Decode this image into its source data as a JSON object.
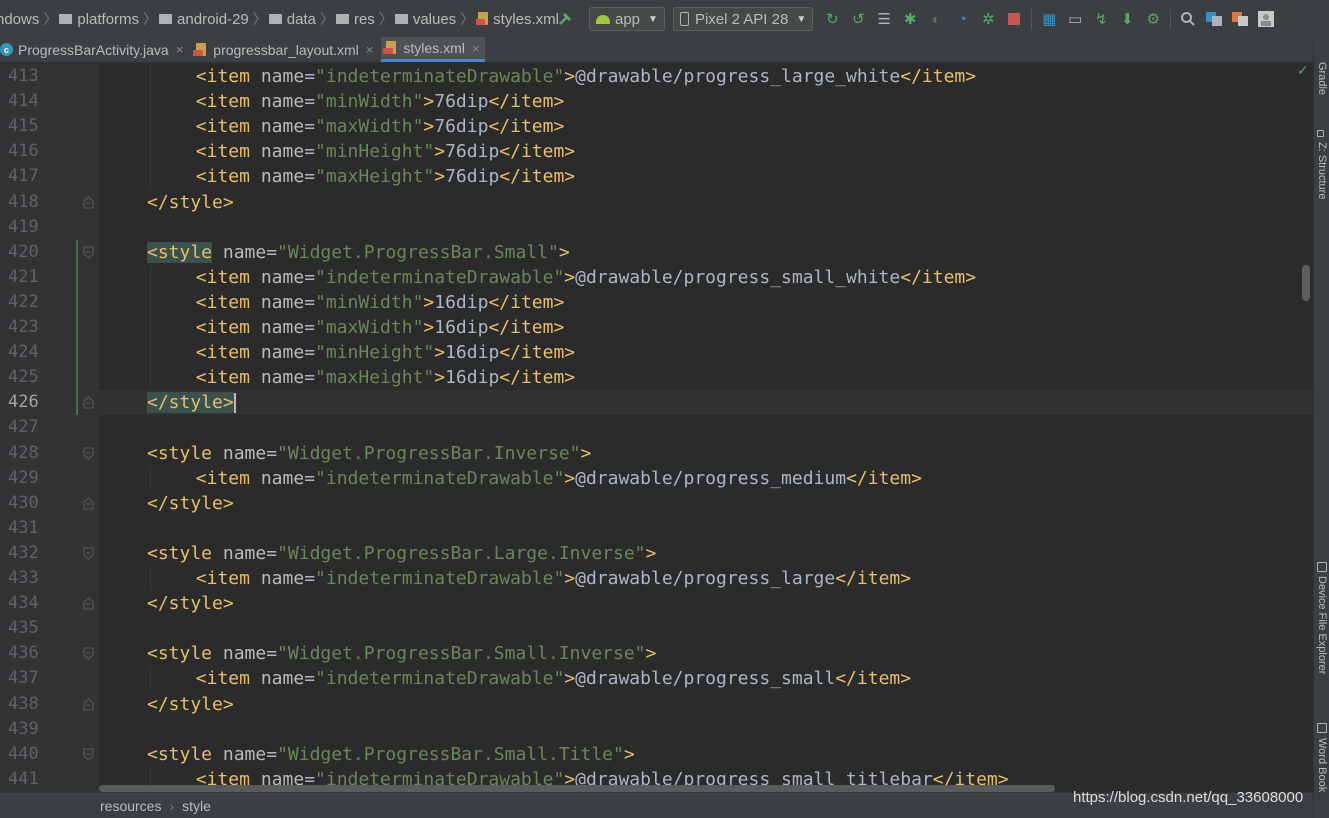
{
  "breadcrumb": [
    "ndows",
    "platforms",
    "android-29",
    "data",
    "res",
    "values",
    "styles.xml"
  ],
  "toolbar": {
    "run_config": "app",
    "device": "Pixel 2 API 28"
  },
  "tabs": [
    {
      "label": "ProgressBarActivity.java",
      "active": false
    },
    {
      "label": "progressbar_layout.xml",
      "active": false
    },
    {
      "label": "styles.xml",
      "active": true
    }
  ],
  "editor": {
    "current_line": 426,
    "lines": [
      {
        "num": "413",
        "indent": 2,
        "tokens": [
          [
            "tg",
            "<item "
          ],
          [
            "at",
            "name"
          ],
          [
            "tx",
            "="
          ],
          [
            "sv",
            "\"indeterminateDrawable\""
          ],
          [
            "tg",
            ">"
          ],
          [
            "tx",
            "@drawable/progress_large_white"
          ],
          [
            "tg",
            "</item>"
          ]
        ]
      },
      {
        "num": "414",
        "indent": 2,
        "tokens": [
          [
            "tg",
            "<item "
          ],
          [
            "at",
            "name"
          ],
          [
            "tx",
            "="
          ],
          [
            "sv",
            "\"minWidth\""
          ],
          [
            "tg",
            ">"
          ],
          [
            "tx",
            "76dip"
          ],
          [
            "tg",
            "</item>"
          ]
        ]
      },
      {
        "num": "415",
        "indent": 2,
        "tokens": [
          [
            "tg",
            "<item "
          ],
          [
            "at",
            "name"
          ],
          [
            "tx",
            "="
          ],
          [
            "sv",
            "\"maxWidth\""
          ],
          [
            "tg",
            ">"
          ],
          [
            "tx",
            "76dip"
          ],
          [
            "tg",
            "</item>"
          ]
        ]
      },
      {
        "num": "416",
        "indent": 2,
        "tokens": [
          [
            "tg",
            "<item "
          ],
          [
            "at",
            "name"
          ],
          [
            "tx",
            "="
          ],
          [
            "sv",
            "\"minHeight\""
          ],
          [
            "tg",
            ">"
          ],
          [
            "tx",
            "76dip"
          ],
          [
            "tg",
            "</item>"
          ]
        ]
      },
      {
        "num": "417",
        "indent": 2,
        "tokens": [
          [
            "tg",
            "<item "
          ],
          [
            "at",
            "name"
          ],
          [
            "tx",
            "="
          ],
          [
            "sv",
            "\"maxHeight\""
          ],
          [
            "tg",
            ">"
          ],
          [
            "tx",
            "76dip"
          ],
          [
            "tg",
            "</item>"
          ]
        ]
      },
      {
        "num": "418",
        "indent": 1,
        "fold": "end",
        "tokens": [
          [
            "tg",
            "</style>"
          ]
        ]
      },
      {
        "num": "419",
        "indent": 0,
        "tokens": []
      },
      {
        "num": "420",
        "indent": 1,
        "fold": "start",
        "tokens": [
          [
            "tgh",
            "<style"
          ],
          [
            "tx",
            " "
          ],
          [
            "at",
            "name"
          ],
          [
            "tx",
            "="
          ],
          [
            "sv",
            "\"Widget.ProgressBar.Small\""
          ],
          [
            "tg",
            ">"
          ]
        ]
      },
      {
        "num": "421",
        "indent": 2,
        "tokens": [
          [
            "tg",
            "<item "
          ],
          [
            "at",
            "name"
          ],
          [
            "tx",
            "="
          ],
          [
            "sv",
            "\"indeterminateDrawable\""
          ],
          [
            "tg",
            ">"
          ],
          [
            "tx",
            "@drawable/progress_small_white"
          ],
          [
            "tg",
            "</item>"
          ]
        ]
      },
      {
        "num": "422",
        "indent": 2,
        "tokens": [
          [
            "tg",
            "<item "
          ],
          [
            "at",
            "name"
          ],
          [
            "tx",
            "="
          ],
          [
            "sv",
            "\"minWidth\""
          ],
          [
            "tg",
            ">"
          ],
          [
            "tx",
            "16dip"
          ],
          [
            "tg",
            "</item>"
          ]
        ]
      },
      {
        "num": "423",
        "indent": 2,
        "tokens": [
          [
            "tg",
            "<item "
          ],
          [
            "at",
            "name"
          ],
          [
            "tx",
            "="
          ],
          [
            "sv",
            "\"maxWidth\""
          ],
          [
            "tg",
            ">"
          ],
          [
            "tx",
            "16dip"
          ],
          [
            "tg",
            "</item>"
          ]
        ]
      },
      {
        "num": "424",
        "indent": 2,
        "tokens": [
          [
            "tg",
            "<item "
          ],
          [
            "at",
            "name"
          ],
          [
            "tx",
            "="
          ],
          [
            "sv",
            "\"minHeight\""
          ],
          [
            "tg",
            ">"
          ],
          [
            "tx",
            "16dip"
          ],
          [
            "tg",
            "</item>"
          ]
        ]
      },
      {
        "num": "425",
        "indent": 2,
        "tokens": [
          [
            "tg",
            "<item "
          ],
          [
            "at",
            "name"
          ],
          [
            "tx",
            "="
          ],
          [
            "sv",
            "\"maxHeight\""
          ],
          [
            "tg",
            ">"
          ],
          [
            "tx",
            "16dip"
          ],
          [
            "tg",
            "</item>"
          ]
        ]
      },
      {
        "num": "426",
        "indent": 1,
        "fold": "end",
        "caret": true,
        "tokens": [
          [
            "tgh",
            "</style>"
          ]
        ]
      },
      {
        "num": "427",
        "indent": 0,
        "tokens": []
      },
      {
        "num": "428",
        "indent": 1,
        "fold": "start",
        "tokens": [
          [
            "tg",
            "<style "
          ],
          [
            "at",
            "name"
          ],
          [
            "tx",
            "="
          ],
          [
            "sv",
            "\"Widget.ProgressBar.Inverse\""
          ],
          [
            "tg",
            ">"
          ]
        ]
      },
      {
        "num": "429",
        "indent": 2,
        "tokens": [
          [
            "tg",
            "<item "
          ],
          [
            "at",
            "name"
          ],
          [
            "tx",
            "="
          ],
          [
            "sv",
            "\"indeterminateDrawable\""
          ],
          [
            "tg",
            ">"
          ],
          [
            "tx",
            "@drawable/progress_medium"
          ],
          [
            "tg",
            "</item>"
          ]
        ]
      },
      {
        "num": "430",
        "indent": 1,
        "fold": "end",
        "tokens": [
          [
            "tg",
            "</style>"
          ]
        ]
      },
      {
        "num": "431",
        "indent": 0,
        "tokens": []
      },
      {
        "num": "432",
        "indent": 1,
        "fold": "start",
        "tokens": [
          [
            "tg",
            "<style "
          ],
          [
            "at",
            "name"
          ],
          [
            "tx",
            "="
          ],
          [
            "sv",
            "\"Widget.ProgressBar.Large.Inverse\""
          ],
          [
            "tg",
            ">"
          ]
        ]
      },
      {
        "num": "433",
        "indent": 2,
        "tokens": [
          [
            "tg",
            "<item "
          ],
          [
            "at",
            "name"
          ],
          [
            "tx",
            "="
          ],
          [
            "sv",
            "\"indeterminateDrawable\""
          ],
          [
            "tg",
            ">"
          ],
          [
            "tx",
            "@drawable/progress_large"
          ],
          [
            "tg",
            "</item>"
          ]
        ]
      },
      {
        "num": "434",
        "indent": 1,
        "fold": "end",
        "tokens": [
          [
            "tg",
            "</style>"
          ]
        ]
      },
      {
        "num": "435",
        "indent": 0,
        "tokens": []
      },
      {
        "num": "436",
        "indent": 1,
        "fold": "start",
        "tokens": [
          [
            "tg",
            "<style "
          ],
          [
            "at",
            "name"
          ],
          [
            "tx",
            "="
          ],
          [
            "sv",
            "\"Widget.ProgressBar.Small.Inverse\""
          ],
          [
            "tg",
            ">"
          ]
        ]
      },
      {
        "num": "437",
        "indent": 2,
        "tokens": [
          [
            "tg",
            "<item "
          ],
          [
            "at",
            "name"
          ],
          [
            "tx",
            "="
          ],
          [
            "sv",
            "\"indeterminateDrawable\""
          ],
          [
            "tg",
            ">"
          ],
          [
            "tx",
            "@drawable/progress_small"
          ],
          [
            "tg",
            "</item>"
          ]
        ]
      },
      {
        "num": "438",
        "indent": 1,
        "fold": "end",
        "tokens": [
          [
            "tg",
            "</style>"
          ]
        ]
      },
      {
        "num": "439",
        "indent": 0,
        "tokens": []
      },
      {
        "num": "440",
        "indent": 1,
        "fold": "start",
        "tokens": [
          [
            "tg",
            "<style "
          ],
          [
            "at",
            "name"
          ],
          [
            "tx",
            "="
          ],
          [
            "sv",
            "\"Widget.ProgressBar.Small.Title\""
          ],
          [
            "tg",
            ">"
          ]
        ]
      },
      {
        "num": "441",
        "indent": 2,
        "tokens": [
          [
            "tg",
            "<item "
          ],
          [
            "at",
            "name"
          ],
          [
            "tx",
            "="
          ],
          [
            "sv",
            "\"indeterminateDrawable\""
          ],
          [
            "tg",
            ">"
          ],
          [
            "tx",
            "@drawable/progress_small_titlebar"
          ],
          [
            "tg",
            "</item>"
          ]
        ]
      }
    ]
  },
  "right_panels": [
    "Gradle",
    "Z: Structure",
    "Device File Explorer",
    "Word Book"
  ],
  "status_breadcrumb": [
    "resources",
    "style"
  ],
  "watermark": "https://blog.csdn.net/qq_33608000",
  "colors": {
    "background": "#2b2b2b",
    "tag": "#e8bf6a",
    "string": "#6a8759",
    "text": "#a9b7c6",
    "accent": "#4a88c7"
  }
}
